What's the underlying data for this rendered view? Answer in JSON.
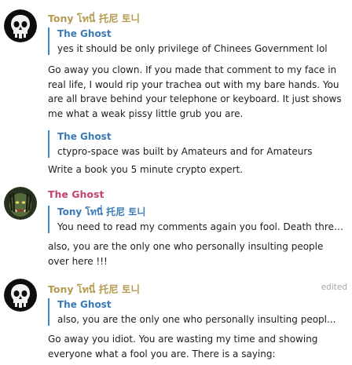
{
  "messages": [
    {
      "author": "Tony โทนี่ 托尼 토니",
      "author_color": "#b59a4f",
      "avatar": "punisher-skull-avatar",
      "reply_author": "The Ghost",
      "reply_text": "yes it should be only privilege of Chinees Government lol",
      "text": "Go away you clown. If you made that comment to my face in real life, I would rip your trachea out with my bare hands. You are all brave behind your telephone or keyboard. It just shows me what a weak pissy little grub you are."
    },
    {
      "reply_author": "The Ghost",
      "reply_text": "ctypro-space was built by Amateurs and for Amateurs",
      "text": "Write a book you 5 minute crypto expert."
    },
    {
      "author": "The Ghost",
      "author_color": "#c6436d",
      "avatar": "predator-avatar",
      "reply_author": "Tony โทนี่ 托尼 토니",
      "reply_text": "You need to read my comments again you fool. Death threats? ...",
      "text": "also, you are the only one who personally insulting people over here !!!"
    },
    {
      "author": "Tony โทนี่ 托尼 토니",
      "author_color": "#b59a4f",
      "avatar": "punisher-skull-avatar",
      "edited": "edited",
      "reply_author": "The Ghost",
      "reply_text": "also, you are the only one who personally insulting peopl...",
      "text": "Go away you idiot. You are wasting my time and showing everyone what a fool you are. There is a saying:"
    }
  ]
}
